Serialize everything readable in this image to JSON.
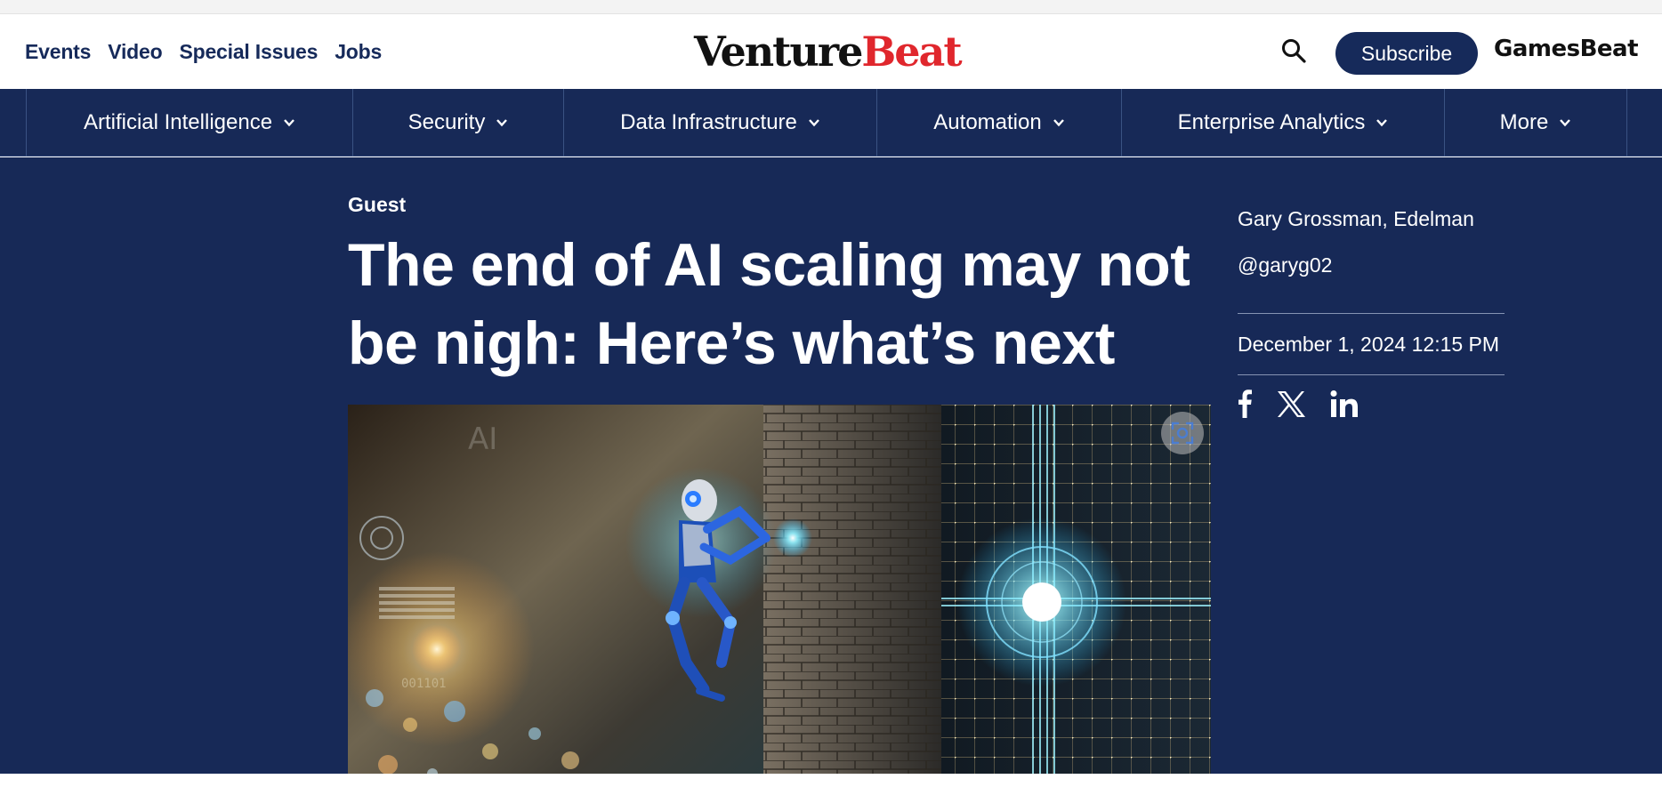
{
  "header": {
    "utility_nav": [
      "Events",
      "Video",
      "Special Issues",
      "Jobs"
    ],
    "logo": {
      "part1": "Venture",
      "part2": "Beat"
    },
    "search_icon": "search-icon",
    "subscribe_label": "Subscribe",
    "gamesbeat_label": "GamesBeat"
  },
  "category_nav": {
    "items": [
      "Artificial Intelligence",
      "Security",
      "Data Infrastructure",
      "Automation",
      "Enterprise Analytics",
      "More"
    ],
    "dropdown_icon": "chevron-down-icon"
  },
  "article": {
    "kicker": "Guest",
    "headline_line1": "The end of AI scaling may not",
    "headline_line2": "be nigh: Here’s what’s next",
    "byline": "Gary Grossman, Edelman",
    "handle": "@garyg02",
    "date": "December 1, 2024 12:15 PM",
    "share_icons": [
      "facebook-icon",
      "x-icon",
      "linkedin-icon"
    ]
  },
  "featured_image": {
    "overlay_text_ai": "AI",
    "overlay_digits": "001101",
    "lens_icon": "visual-search-icon"
  },
  "colors": {
    "navy": "#172957",
    "brand_red": "#e0272d",
    "link_navy": "#162a5a"
  }
}
